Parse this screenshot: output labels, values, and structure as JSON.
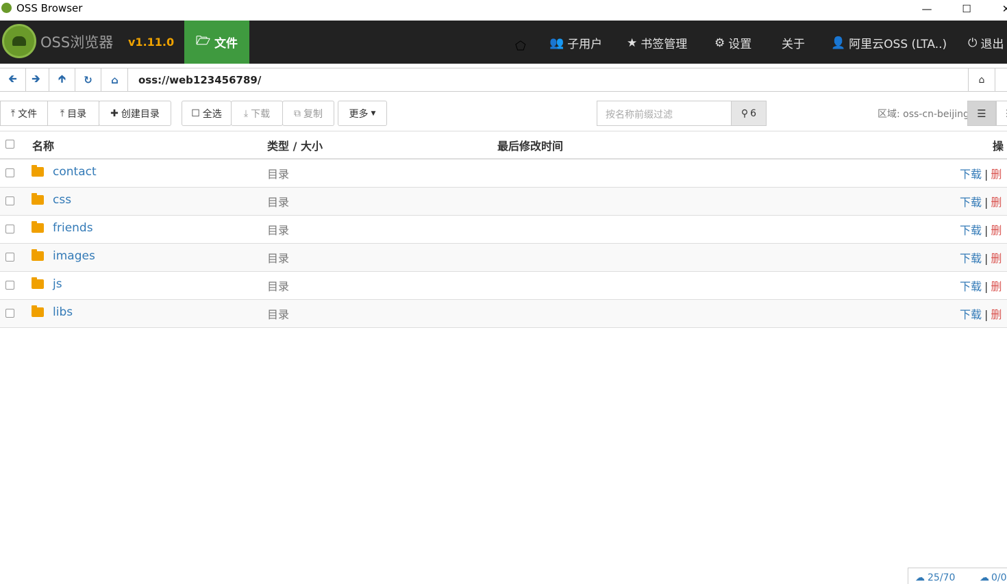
{
  "window": {
    "title": "OSS Browser"
  },
  "nav": {
    "brand": "OSS浏览器",
    "version": "v1.11.0",
    "files_tab": "文件",
    "items": [
      {
        "label": "子用户",
        "icon": "users-icon"
      },
      {
        "label": "书签管理",
        "icon": "star-icon"
      },
      {
        "label": "设置",
        "icon": "gear-icon"
      },
      {
        "label": "关于",
        "icon": ""
      },
      {
        "label": "阿里云OSS (LTA..)",
        "icon": "user-icon"
      },
      {
        "label": "退出",
        "icon": "power-icon"
      }
    ]
  },
  "address": {
    "path": "oss://web123456789/"
  },
  "toolbar": {
    "upload_file": "文件",
    "upload_dir": "目录",
    "create_dir": "创建目录",
    "select_all": "全选",
    "download": "下载",
    "copy": "复制",
    "more": "更多",
    "filter_placeholder": "按名称前缀过滤",
    "count": "6",
    "region": "区域: oss-cn-beijing"
  },
  "table": {
    "headers": {
      "name": "名称",
      "type_size": "类型 / 大小",
      "modified": "最后修改时间",
      "actions": "操"
    },
    "rows": [
      {
        "name": "contact",
        "type": "目录"
      },
      {
        "name": "css",
        "type": "目录"
      },
      {
        "name": "friends",
        "type": "目录"
      },
      {
        "name": "images",
        "type": "目录"
      },
      {
        "name": "js",
        "type": "目录"
      },
      {
        "name": "libs",
        "type": "目录"
      }
    ],
    "download_label": "下载",
    "delete_label": "删"
  },
  "status": {
    "upload": "25/70",
    "download": "0/0"
  },
  "colors": {
    "accent": "#3f9a3f",
    "version": "#f0a300",
    "link": "#337ab7",
    "danger": "#d9534f"
  }
}
